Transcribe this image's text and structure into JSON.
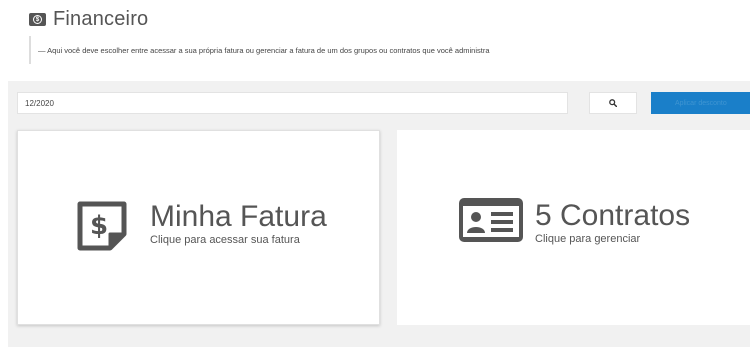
{
  "header": {
    "icon": "money-icon",
    "title": "Financeiro"
  },
  "subtitle": "— Aqui você deve escolher entre acessar a sua própria fatura ou gerenciar a fatura de um dos grupos ou contratos que você administra",
  "filter": {
    "period_value": "12/2020",
    "search_icon": "search-icon",
    "apply_label": "Aplicar desconto"
  },
  "cards": {
    "own": {
      "icon": "invoice-dollar-icon",
      "title": "Minha Fatura",
      "subtitle": "Clique para acessar sua fatura"
    },
    "contracts": {
      "icon": "id-card-icon",
      "title": "5 Contratos",
      "subtitle": "Clique para gerenciar"
    }
  },
  "colors": {
    "accent": "#1a7fc9",
    "panel_bg": "#f1f1f1",
    "icon": "#555555"
  }
}
